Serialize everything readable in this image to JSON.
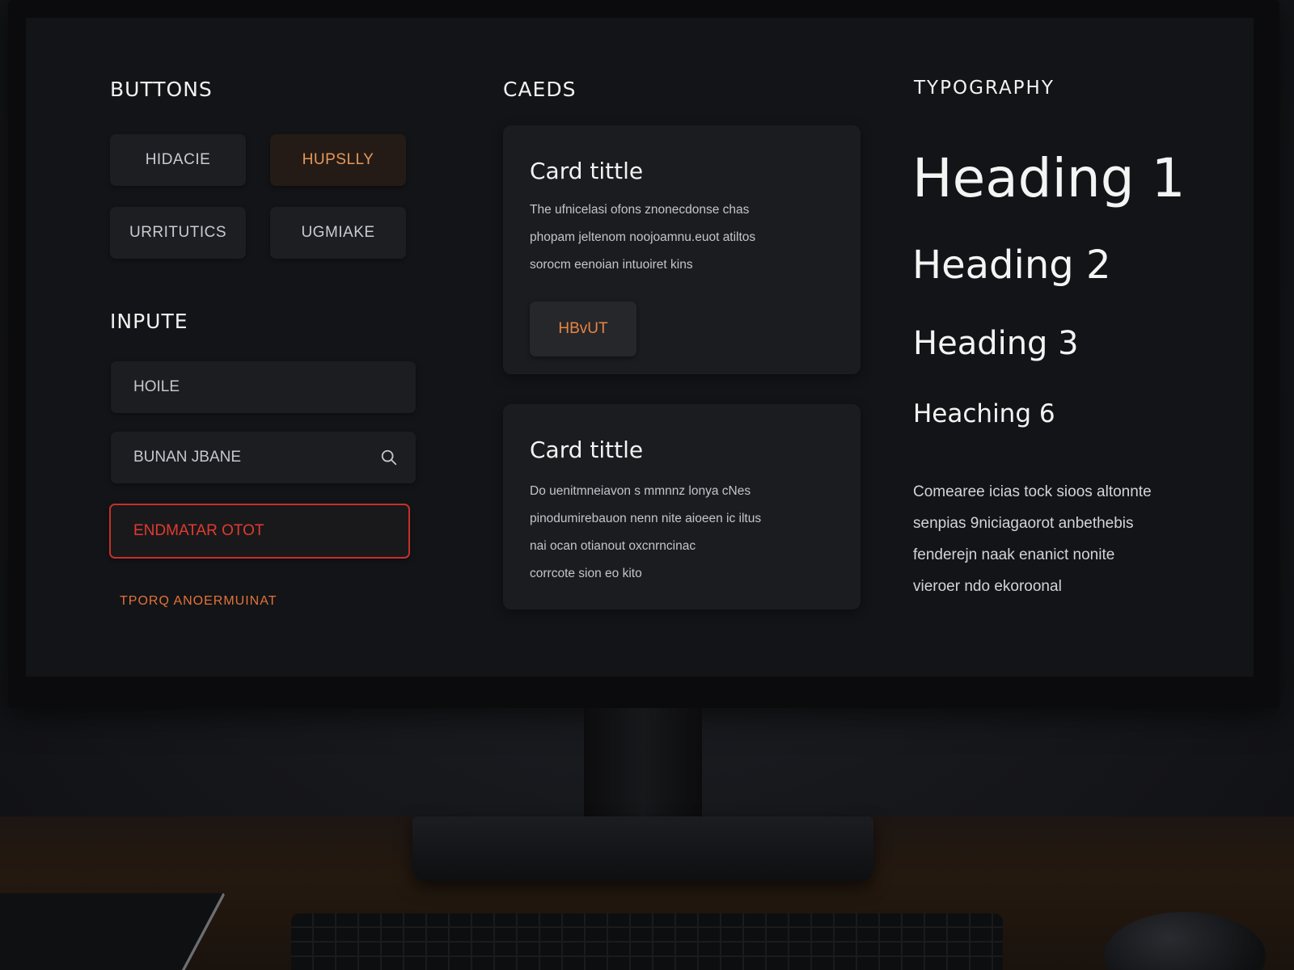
{
  "sections": {
    "buttons_title": "BUTTONS",
    "cards_title": "CAEDS",
    "typography_title": "TYPOGRAPHY",
    "inputs_title": "INPUTE"
  },
  "buttons": {
    "btn1": "HIDACIE",
    "btn2": "HUPSLLY",
    "btn3": "URRITUTICS",
    "btn4": "UGMIAKE"
  },
  "inputs": {
    "field1_value": "HOILE",
    "field2_value": "BUNAN JBANE",
    "field3_value": "ENDMATAR OTOT",
    "helper_text": "TPORQ ANOERMUINAT"
  },
  "cards": [
    {
      "title": "Card tittle",
      "lines": [
        "The ufnicelasi ofons znonecdonse chas",
        "phopam jeltenom noojoamnu.euot atiltos",
        "sorocm eenoian intuoiret kins"
      ],
      "button": "HBvUT"
    },
    {
      "title": "Card tittle",
      "lines": [
        "Do uenitmneiavon s mmnnz lonya cNes",
        "pinodumirebauon nenn nite aioeen ic iltus",
        "nai ocan otianout oxcnrncinac",
        "corrcote sion eo kito"
      ]
    }
  ],
  "typography": {
    "h1": "Heading 1",
    "h2": "Heading 2",
    "h3": "Heading 3",
    "h4": "Heaching 6",
    "body_lines": [
      "Comearee icias tock sioos altonnte",
      "senpias 9niciagaorot anbethebis",
      "fenderejn naak enanict nonite",
      "vieroer ndo ekoroonal"
    ]
  },
  "colors": {
    "accent": "#e8863f",
    "error": "#e23a2e",
    "background": "#131417",
    "surface": "#1b1c20"
  }
}
